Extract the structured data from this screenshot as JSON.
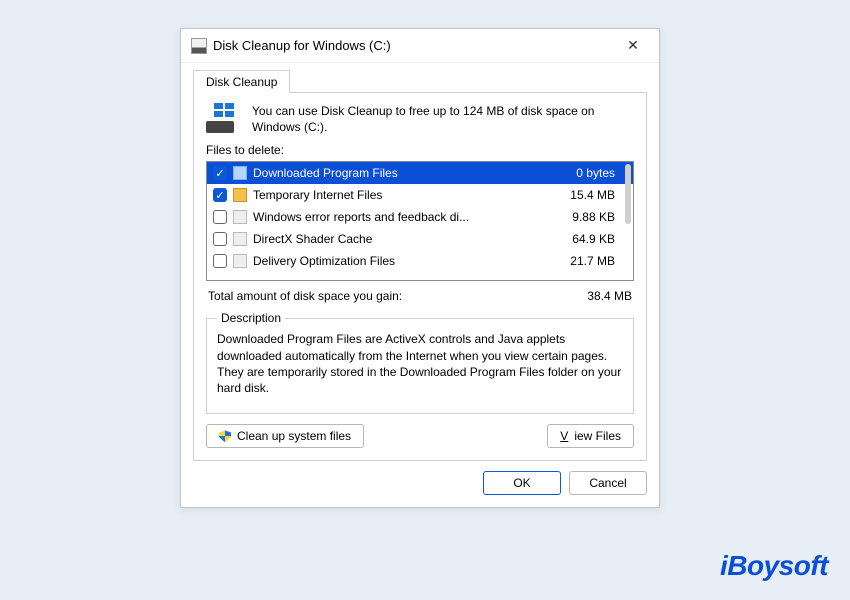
{
  "window": {
    "title": "Disk Cleanup for Windows (C:)"
  },
  "tab": {
    "label": "Disk Cleanup"
  },
  "intro": {
    "message": "You can use Disk Cleanup to free up to 124 MB of disk space on Windows (C:)."
  },
  "files_label": "Files to delete:",
  "files": [
    {
      "checked": true,
      "icon": "folder",
      "name": "Downloaded Program Files",
      "size": "0 bytes",
      "selected": true
    },
    {
      "checked": true,
      "icon": "lock",
      "name": "Temporary Internet Files",
      "size": "15.4 MB",
      "selected": false
    },
    {
      "checked": false,
      "icon": "file",
      "name": "Windows error reports and feedback di...",
      "size": "9.88 KB",
      "selected": false
    },
    {
      "checked": false,
      "icon": "file",
      "name": "DirectX Shader Cache",
      "size": "64.9 KB",
      "selected": false
    },
    {
      "checked": false,
      "icon": "file",
      "name": "Delivery Optimization Files",
      "size": "21.7 MB",
      "selected": false
    }
  ],
  "total": {
    "label": "Total amount of disk space you gain:",
    "value": "38.4 MB"
  },
  "description": {
    "legend": "Description",
    "text": "Downloaded Program Files are ActiveX controls and Java applets downloaded automatically from the Internet when you view certain pages. They are temporarily stored in the Downloaded Program Files folder on your hard disk."
  },
  "buttons": {
    "clean_system": "Clean up system files",
    "view_files": "View Files",
    "ok": "OK",
    "cancel": "Cancel"
  },
  "watermark": "iBoysoft"
}
